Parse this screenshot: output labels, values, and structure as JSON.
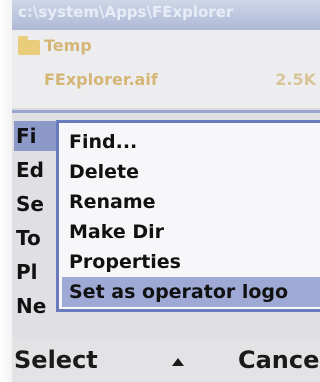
{
  "path_bar": {
    "path": "c:\\system\\Apps\\FExplorer"
  },
  "file_list": {
    "rows": [
      {
        "name": "Temp",
        "icon": "folder-icon",
        "size": ""
      },
      {
        "name": "FExplorer.aif",
        "icon": "",
        "size": "2.5K"
      }
    ]
  },
  "main_pane": {
    "items": [
      {
        "label": "Fi"
      },
      {
        "label": "Ed"
      },
      {
        "label": "Se"
      },
      {
        "label": "To"
      },
      {
        "label": "Pl"
      },
      {
        "label": "Ne"
      }
    ],
    "selected_index": 0
  },
  "context_menu": {
    "items": [
      {
        "label": "Find..."
      },
      {
        "label": "Delete"
      },
      {
        "label": "Rename"
      },
      {
        "label": "Make Dir"
      },
      {
        "label": "Properties"
      },
      {
        "label": "Set as operator logo"
      }
    ],
    "highlighted_index": 5
  },
  "softkeys": {
    "left": "Select",
    "center_icon": "up-arrow-icon",
    "right": "Cancel"
  },
  "colors": {
    "highlight": "#9ea9d6",
    "menu_border": "#6a7bbd",
    "folder": "#e9cd7a"
  }
}
